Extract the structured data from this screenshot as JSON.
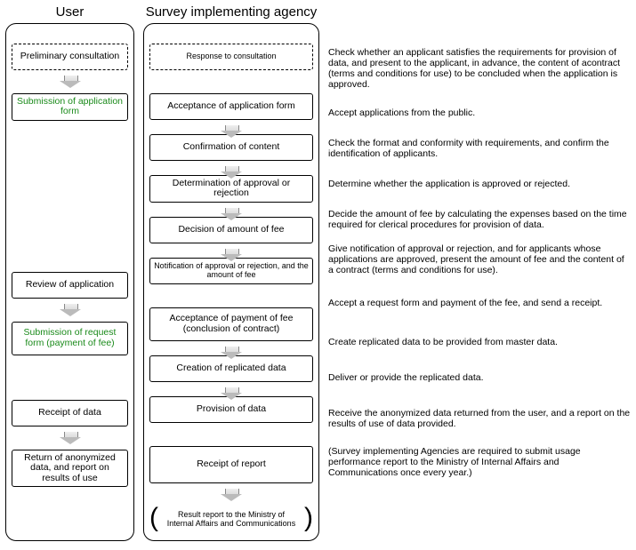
{
  "lanes": {
    "user": "User",
    "agency": "Survey implementing agency"
  },
  "user_steps": {
    "prelim": "Preliminary consultation",
    "submit_app": "Submission of application form",
    "review_app": "Review of application",
    "submit_request": "Submission of request form (payment of fee)",
    "receipt_data": "Receipt of data",
    "return_report": "Return of anonymized data, and report on results of use"
  },
  "agency_steps": {
    "response": "Response to consultation",
    "accept_app": "Acceptance of application form",
    "confirm": "Confirmation of content",
    "determine": "Determination of approval or rejection",
    "decide_fee": "Decision of amount of fee",
    "notify": "Notification of approval or rejection, and the amount of fee",
    "accept_payment": "Acceptance of payment of fee (conclusion of contract)",
    "create_replicated": "Creation of replicated data",
    "provision": "Provision of data",
    "receipt_report": "Receipt of report",
    "result_report": "Result report to the Ministry of Internal Affairs and Communications"
  },
  "descriptions": {
    "d1": "Check whether an applicant satisfies the requirements for provision of data, and present to the applicant, in advance, the content of acontract (terms and conditions for use) to be concluded when the application is approved.",
    "d2": "Accept applications from the public.",
    "d3": "Check the format and conformity with requirements, and confirm the identification of applicants.",
    "d4": "Determine whether the application is approved or rejected.",
    "d5": "Decide the amount of fee by calculating the expenses based on the time required for clerical procedures for provision of data.",
    "d6": "Give notification of approval or rejection, and for applicants whose applications are approved, present the amount of fee and the content of a contract (terms and conditions for use).",
    "d7": "Accept a request form and payment of the fee, and send a receipt.",
    "d8": "Create replicated data to be provided from master data.",
    "d9": "Deliver or provide the replicated data.",
    "d10": "Receive the anonymized data returned from the user, and a report on the results of use of data provided.",
    "d11": "(Survey implementing Agencies are required to submit usage performance report to the Ministry of Internal Affairs and Communications once every year.)"
  },
  "chart_data": {
    "type": "table",
    "title": "Data provision procedure swimlane (User vs Survey implementing agency)",
    "lanes": [
      "User",
      "Survey implementing agency"
    ],
    "rows": [
      {
        "user": "Preliminary consultation",
        "agency": "Response to consultation",
        "description": "Check whether an applicant satisfies the requirements for provision of data, and present to the applicant, in advance, the content of a contract (terms and conditions for use) to be concluded when the application is approved.",
        "flow": "user→agency (dashed)"
      },
      {
        "user": "Submission of application form",
        "agency": "Acceptance of application form",
        "description": "Accept applications from the public.",
        "flow": "user→agency"
      },
      {
        "user": "",
        "agency": "Confirmation of content",
        "description": "Check the format and conformity with requirements, and confirm the identification of applicants.",
        "flow": "agency↓"
      },
      {
        "user": "",
        "agency": "Determination of approval or rejection",
        "description": "Determine whether the application is approved or rejected.",
        "flow": "agency↓"
      },
      {
        "user": "",
        "agency": "Decision of amount of fee",
        "description": "Decide the amount of fee by calculating the expenses based on the time required for clerical procedures for provision of data.",
        "flow": "agency↓"
      },
      {
        "user": "Review of application",
        "agency": "Notification of approval or rejection, and the amount of fee",
        "description": "Give notification of approval or rejection, and for applicants whose applications are approved, present the amount of fee and the content of a contract (terms and conditions for use).",
        "flow": "agency→user"
      },
      {
        "user": "Submission of request form (payment of fee)",
        "agency": "Acceptance of payment of fee (conclusion of contract)",
        "description": "Accept a request form and payment of the fee, and send a receipt.",
        "flow": "user→agency"
      },
      {
        "user": "",
        "agency": "Creation of replicated data",
        "description": "Create replicated data to be provided from master data.",
        "flow": "agency↓"
      },
      {
        "user": "Receipt of data",
        "agency": "Provision of data",
        "description": "Deliver or provide the replicated data.",
        "flow": "agency→user"
      },
      {
        "user": "Return of anonymized data, and report on results of use",
        "agency": "Receipt of report",
        "description": "Receive the anonymized data returned from the user, and a report on the results of use of data provided.",
        "flow": "user→agency"
      },
      {
        "user": "",
        "agency": "Result report to the Ministry of Internal Affairs and Communications",
        "description": "(Survey implementing Agencies are required to submit usage performance report to the Ministry of Internal Affairs and Communications once every year.)",
        "flow": "agency↓"
      }
    ]
  }
}
